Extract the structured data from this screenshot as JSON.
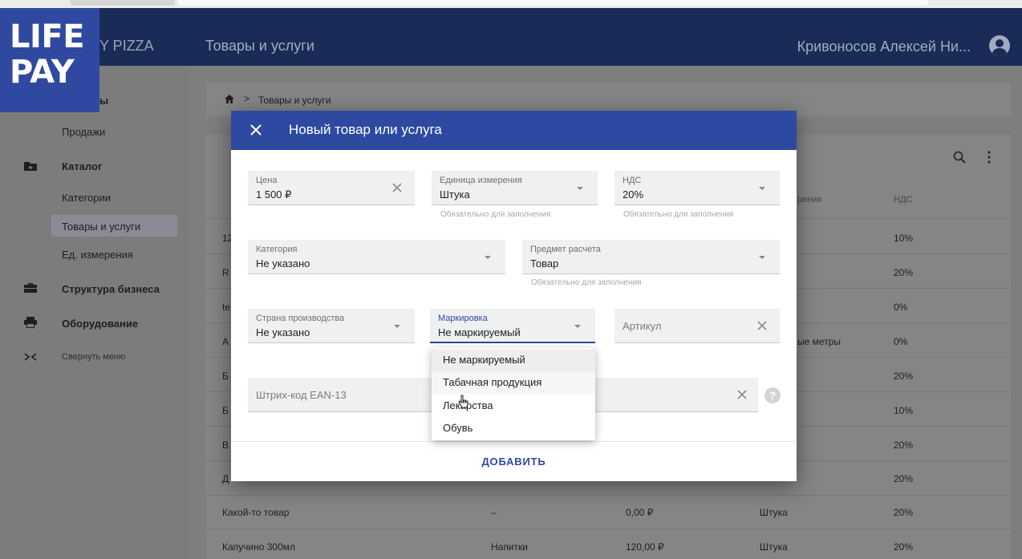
{
  "brand": {
    "line1": "LIFE",
    "line2": "PAY"
  },
  "header": {
    "app_name": "Y PIZZA",
    "page_title": "Товары и услуги",
    "user_name": "Кривоносов Алексей Ни..."
  },
  "sidebar": {
    "items": [
      {
        "label": "ы"
      },
      {
        "label": "Продажи"
      },
      {
        "label": "Каталог"
      },
      {
        "label": "Категории"
      },
      {
        "label": "Товары и услуги"
      },
      {
        "label": "Ед. измерения"
      },
      {
        "label": "Структура бизнеса"
      },
      {
        "label": "Оборудование"
      },
      {
        "label": "Свернуть меню"
      }
    ]
  },
  "breadcrumb": {
    "separator": ">",
    "current": "Товары и услуги"
  },
  "table": {
    "header_unit": "рения",
    "header_vat": "НДС",
    "rows": [
      {
        "name": "12",
        "category": "",
        "price": "",
        "unit": "",
        "vat": "10%"
      },
      {
        "name": "R",
        "category": "",
        "price": "",
        "unit": "",
        "vat": "20%"
      },
      {
        "name": "te",
        "category": "",
        "price": "",
        "unit": "",
        "vat": "0%"
      },
      {
        "name": "А",
        "category": "",
        "price": "",
        "unit": "ые метры",
        "vat": "0%"
      },
      {
        "name": "Б",
        "category": "",
        "price": "",
        "unit": "",
        "vat": "20%"
      },
      {
        "name": "Б",
        "category": "",
        "price": "",
        "unit": "",
        "vat": "10%"
      },
      {
        "name": "В",
        "category": "",
        "price": "",
        "unit": "",
        "vat": "20%"
      },
      {
        "name": "Д",
        "category": "",
        "price": "",
        "unit": "",
        "vat": "20%"
      },
      {
        "name": "Какой-то товар",
        "category": "–",
        "price": "0,00 ₽",
        "unit": "Штука",
        "vat": "20%"
      },
      {
        "name": "Капучино 300мл",
        "category": "Напитки",
        "price": "120,00 ₽",
        "unit": "Штука",
        "vat": "20%"
      }
    ]
  },
  "modal": {
    "title": "Новый товар или услуга",
    "price": {
      "label": "Цена",
      "value": "1 500 ₽"
    },
    "unit": {
      "label": "Единица измерения",
      "value": "Штука",
      "hint": "Обязательно для заполнения"
    },
    "vat": {
      "label": "НДС",
      "value": "20%",
      "hint": "Обязательно для заполнения"
    },
    "category": {
      "label": "Категория",
      "value": "Не указано"
    },
    "subject": {
      "label": "Предмет расчета",
      "value": "Товар",
      "hint": "Обязательно для заполнения"
    },
    "country": {
      "label": "Страна производства",
      "value": "Не указано"
    },
    "marking": {
      "label": "Маркировка",
      "value": "Не маркируемый"
    },
    "article": {
      "placeholder": "Артикул"
    },
    "barcode": {
      "placeholder": "Штрих-код EAN-13"
    },
    "help": "?",
    "submit_label": "ДОБАВИТЬ"
  },
  "marking_dropdown": {
    "options": [
      "Не маркируемый",
      "Табачная продукция",
      "Лекарства",
      "Обувь"
    ],
    "selected": "Не маркируемый"
  },
  "colors": {
    "header_bg": "#192b56",
    "brand_bg": "#3049a0",
    "modal_header": "#2e4aa0",
    "accent": "#2e4aa0"
  },
  "icons": [
    "home-icon",
    "search-icon",
    "more-vertical-icon",
    "user-avatar-icon",
    "close-icon",
    "chevron-down-icon",
    "clear-icon",
    "help-icon",
    "catalog-folder-icon",
    "briefcase-icon",
    "printer-icon",
    "collapse-icon",
    "cursor-icon"
  ]
}
